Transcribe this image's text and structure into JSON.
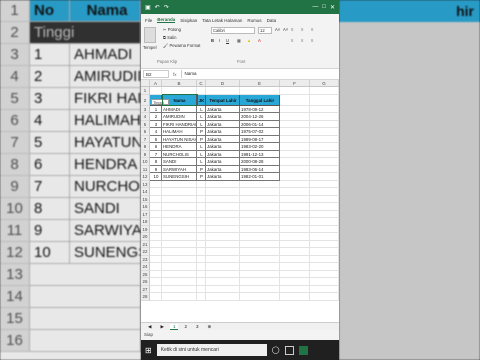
{
  "title_bar": {
    "autosave": "",
    "title": ""
  },
  "ribbon_tabs": [
    "File",
    "Beranda",
    "Sisipkan",
    "Tata Letak Halaman",
    "Rumus",
    "Data"
  ],
  "ribbon": {
    "paste": "Tempel",
    "cut": "Potong",
    "copy": "Salin",
    "format_painter": "Pewarna Format",
    "clipboard_group": "Papan Klip",
    "font_name": "Calibri",
    "font_size": "12",
    "font_group": "Font"
  },
  "formula_bar": {
    "cell_ref": "B2",
    "fx": "fx",
    "value": "Nama"
  },
  "columns": [
    "A",
    "B",
    "C",
    "D",
    "E",
    "F",
    "G"
  ],
  "table": {
    "headers": [
      "No",
      "Nama",
      "JK",
      "Tempat Lahir",
      "Tanggal Lahir"
    ],
    "rows": [
      [
        "1",
        "AHMADI",
        "L",
        "Jakarta",
        "1978-09-12"
      ],
      [
        "2",
        "AMIRUDIN",
        "L",
        "Jakarta",
        "2004-12-26"
      ],
      [
        "3",
        "FIKRI HANDRIAN",
        "L",
        "Jakarta",
        "2006-01-14"
      ],
      [
        "4",
        "HALIMAH",
        "P",
        "Jakarta",
        "1975-07-02"
      ],
      [
        "5",
        "HAYATUN NISAH",
        "P",
        "Jakarta",
        "1989-08-17"
      ],
      [
        "6",
        "HENDRA",
        "L",
        "Jakarta",
        "1983-02-20"
      ],
      [
        "7",
        "NURCHOLIS",
        "L",
        "Jakarta",
        "1991-12-13"
      ],
      [
        "8",
        "SANDI",
        "L",
        "Jakarta",
        "2000-08-28"
      ],
      [
        "9",
        "SARWIYAH",
        "P",
        "Jakarta",
        "1983-06-14"
      ],
      [
        "10",
        "SUNENGSIH",
        "P",
        "Jakarta",
        "1982-01-01"
      ]
    ]
  },
  "tooltip": "Tinggi",
  "row_numbers": [
    "1",
    "2",
    "3",
    "4",
    "5",
    "6",
    "7",
    "8",
    "9",
    "10",
    "11",
    "12",
    "13",
    "14",
    "15",
    "16",
    "17",
    "18",
    "19",
    "20",
    "21",
    "22",
    "23",
    "24",
    "25",
    "26",
    "27",
    "28"
  ],
  "sheet_tabs": [
    "1",
    "2",
    "3"
  ],
  "status": "Siap",
  "taskbar": {
    "search_placeholder": "Ketik di sini untuk mencari"
  },
  "colors": {
    "excel_green": "#217346",
    "header_fill": "#29a8d8"
  }
}
